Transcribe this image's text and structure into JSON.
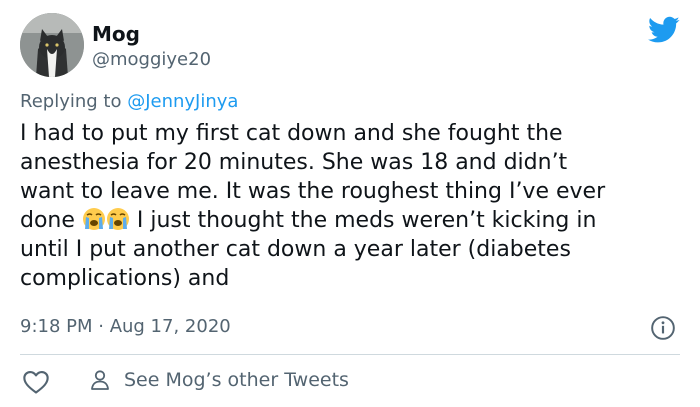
{
  "author": {
    "display_name": "Mog",
    "handle": "@moggiye20"
  },
  "reply": {
    "prefix": "Replying to ",
    "mention": "@JennyJinya"
  },
  "tweet": {
    "lines": [
      "I had to put my first cat down and she fought the",
      "anesthesia for 20 minutes. She was 18 and didn’t",
      "want to leave me. It was the roughest thing I’ve ever",
      "done",
      " I just thought the meds weren’t kicking in",
      "until I put another cat down a year later (diabetes",
      "complications) and"
    ],
    "emoji": "loudly-crying-face-emoji"
  },
  "timestamp": "9:18 PM · Aug 17, 2020",
  "actions": {
    "see_other": "See Mog’s other Tweets"
  },
  "colors": {
    "brand_blue": "#1d9bf0",
    "muted_text": "#536471",
    "divider": "#cfd9de"
  },
  "icons": [
    "twitter-bird-icon",
    "info-icon",
    "heart-icon",
    "person-icon"
  ]
}
